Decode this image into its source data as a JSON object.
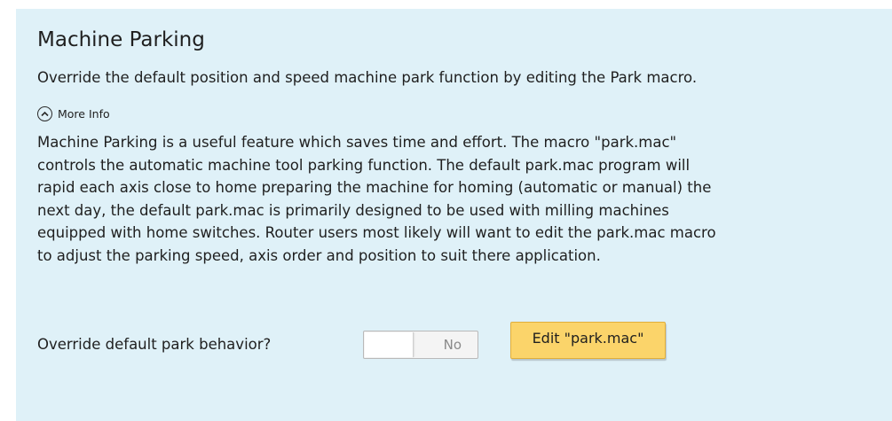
{
  "section": {
    "title": "Machine Parking",
    "subtitle": "Override the default position and speed machine park function by editing the Park macro.",
    "more_info_label": "More Info",
    "more_info_icon": "chevron-up-icon",
    "description_lines": [
      "Machine Parking is a useful feature which saves time and effort.  The macro \"park.mac\"",
      "controls the automatic machine tool parking function.  The default park.mac program will",
      "rapid each axis close to home preparing the machine for homing (automatic or manual) the",
      "next day, the default park.mac is primarily designed to be used with milling machines",
      "equipped with home switches.  Router users most likely will want to edit the park.mac macro",
      "to adjust the parking speed, axis order and position to suit there application."
    ]
  },
  "override": {
    "label": "Override default park behavior?",
    "toggle_state": "No",
    "edit_button_label": "Edit \"park.mac\""
  },
  "colors": {
    "panel_background": "#dff1f8",
    "button_background": "#fbd46a",
    "text": "#1f1f1f"
  }
}
